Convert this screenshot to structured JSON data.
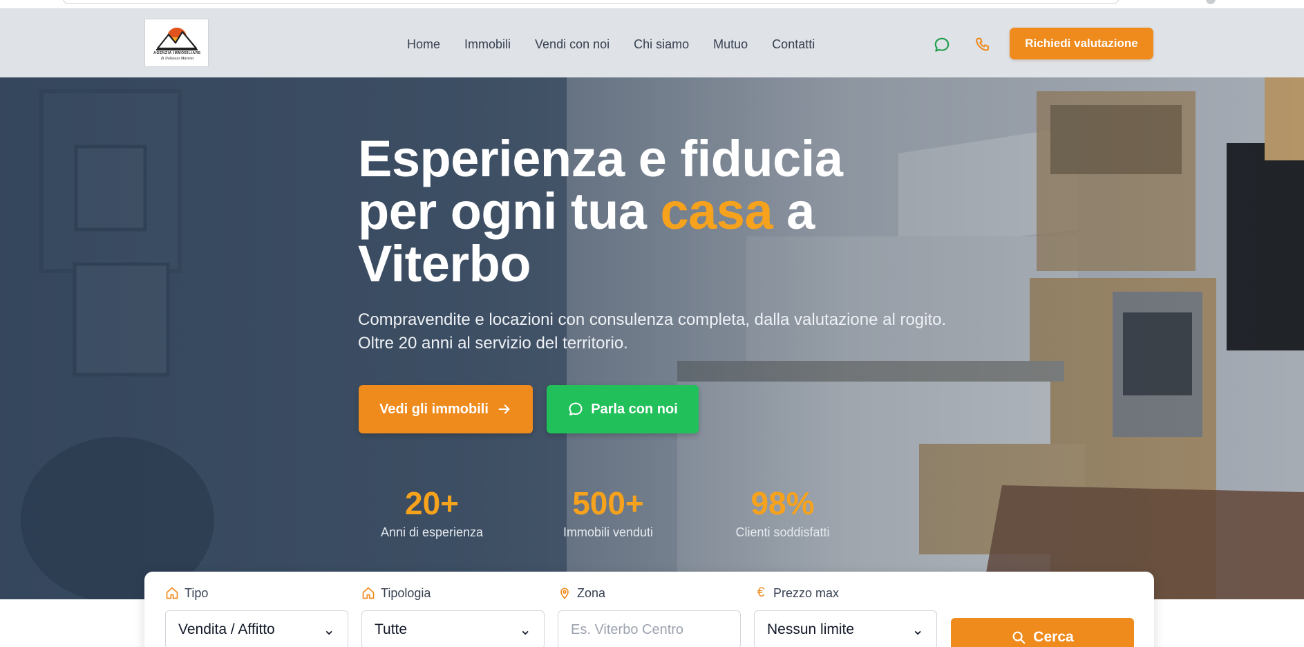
{
  "logo": {
    "line1": "AGENZIA IMMOBILIARE",
    "line2": "di Nolassia Marena"
  },
  "nav": {
    "items": [
      "Home",
      "Immobili",
      "Vendi con noi",
      "Chi siamo",
      "Mutuo",
      "Contatti"
    ]
  },
  "header": {
    "cta_label": "Richiedi valutazione",
    "chat_icon": "chat-icon",
    "phone_icon": "phone-icon"
  },
  "hero": {
    "title_line1": "Esperienza e fiducia",
    "title_line2_a": "per ogni tua ",
    "title_line2_accent": "casa",
    "title_line2_b": " a",
    "title_line3": "Viterbo",
    "subtitle": "Compravendite e locazioni con consulenza completa, dalla valutazione al rogito. Oltre 20 anni al servizio del territorio.",
    "primary_button": "Vedi gli immobili",
    "secondary_button": "Parla con noi"
  },
  "stats": [
    {
      "value": "20+",
      "label": "Anni di esperienza"
    },
    {
      "value": "500+",
      "label": "Immobili venduti"
    },
    {
      "value": "98%",
      "label": "Clienti soddisfatti"
    }
  ],
  "search": {
    "tipo_label": "Tipo",
    "tipo_value": "Vendita / Affitto",
    "tipologia_label": "Tipologia",
    "tipologia_value": "Tutte",
    "zona_label": "Zona",
    "zona_placeholder": "Es. Viterbo Centro",
    "prezzo_label": "Prezzo max",
    "prezzo_value": "Nessun limite",
    "button_label": "Cerca"
  },
  "colors": {
    "accent": "#ef8a1c",
    "green": "#22c05a",
    "hero_overlay": "#2c3e55"
  }
}
